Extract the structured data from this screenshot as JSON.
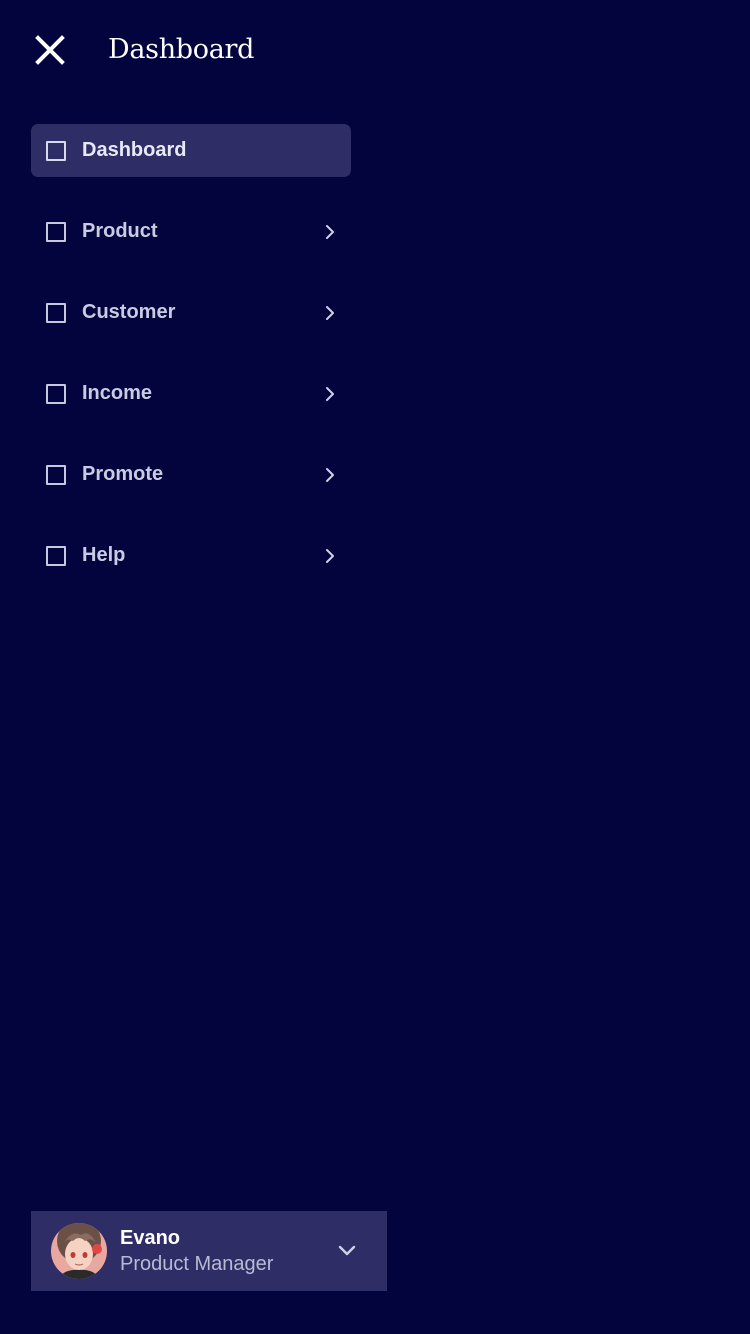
{
  "header": {
    "title": "Dashboard",
    "close_icon": "close-icon"
  },
  "nav": {
    "items": [
      {
        "label": "Dashboard",
        "icon": "square-icon",
        "active": true,
        "has_chevron": false
      },
      {
        "label": "Product",
        "icon": "square-icon",
        "active": false,
        "has_chevron": true
      },
      {
        "label": "Customer",
        "icon": "square-icon",
        "active": false,
        "has_chevron": true
      },
      {
        "label": "Income",
        "icon": "square-icon",
        "active": false,
        "has_chevron": true
      },
      {
        "label": "Promote",
        "icon": "square-icon",
        "active": false,
        "has_chevron": true
      },
      {
        "label": "Help",
        "icon": "square-icon",
        "active": false,
        "has_chevron": true
      }
    ]
  },
  "user": {
    "name": "Evano",
    "role": "Product Manager",
    "avatar_icon": "avatar",
    "dropdown_icon": "chevron-down-icon"
  },
  "colors": {
    "background": "#03043d",
    "active_item": "#2e2d66",
    "text_primary": "#ffffff",
    "text_secondary": "#c9cbe2"
  }
}
